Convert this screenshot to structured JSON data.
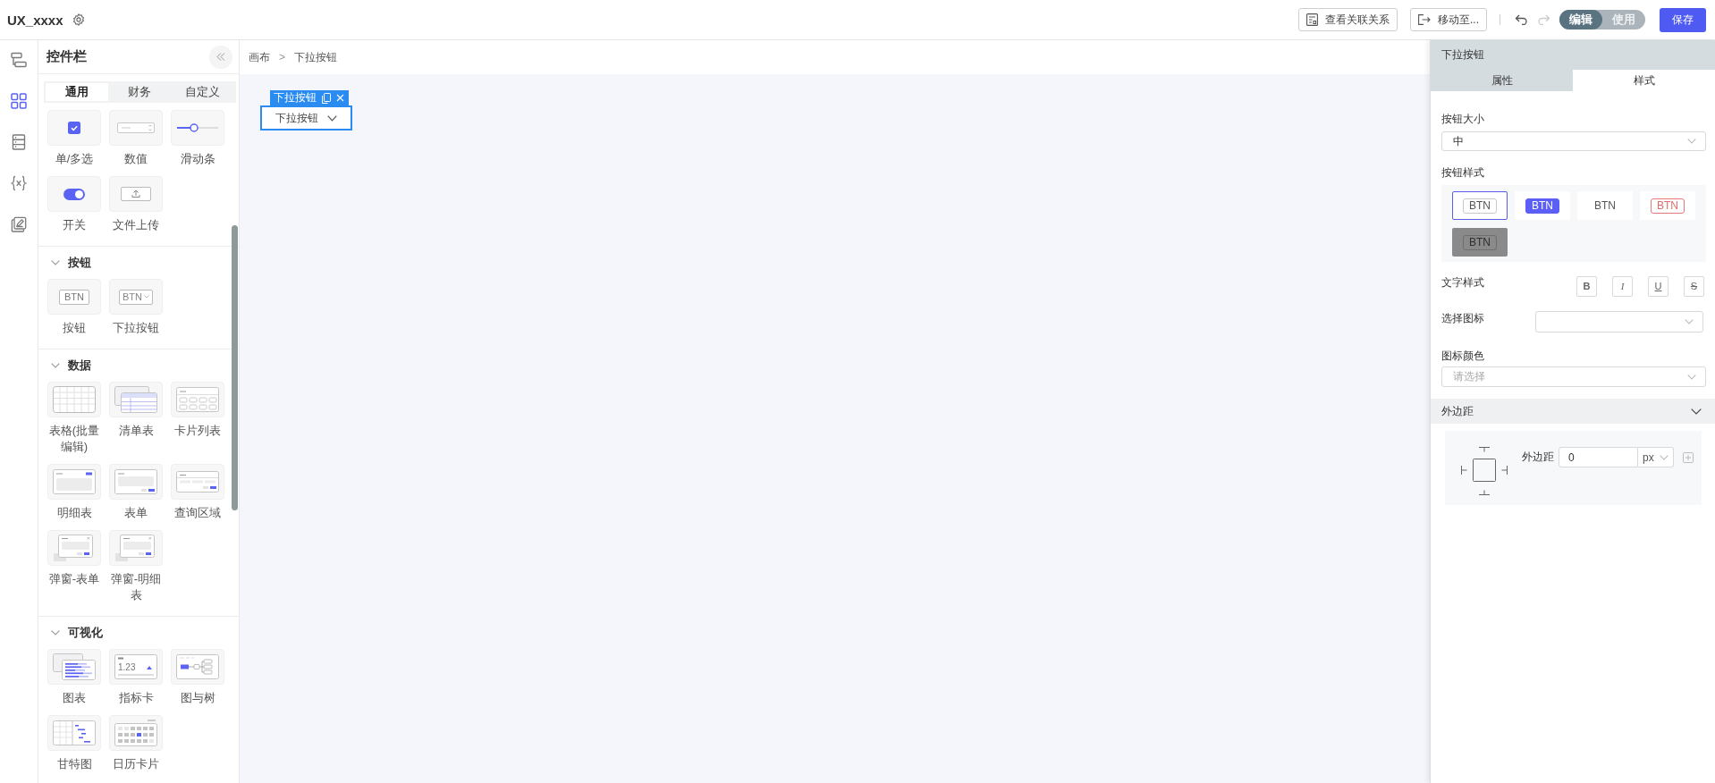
{
  "header": {
    "title": "UX_xxxx",
    "actions": [
      {
        "kind": "relations",
        "label": "查看关联关系"
      },
      {
        "kind": "move",
        "label": "移动至..."
      }
    ],
    "history": [
      {
        "kind": "undo",
        "disabled": false
      },
      {
        "kind": "redo",
        "disabled": true
      }
    ],
    "mode": [
      {
        "label": "编辑",
        "selected": true
      },
      {
        "label": "使用",
        "selected": false
      }
    ],
    "save": {
      "label": "保存"
    }
  },
  "rail": [
    {
      "kind": "layers",
      "selected": false
    },
    {
      "kind": "widgets",
      "selected": true
    },
    {
      "kind": "rows",
      "selected": false
    },
    {
      "kind": "variables",
      "selected": false
    },
    {
      "kind": "edit",
      "selected": false
    }
  ],
  "widget_panel": {
    "title": "控件栏",
    "tabs": [
      {
        "label": "通用",
        "selected": true
      },
      {
        "label": "财务",
        "selected": false
      },
      {
        "label": "自定义",
        "selected": false
      }
    ],
    "sections": [
      {
        "items": [
          {
            "kind": "checkbox",
            "label": "单/多选"
          },
          {
            "kind": "number",
            "label": "数值"
          },
          {
            "kind": "slider",
            "label": "滑动条"
          },
          {
            "kind": "switch",
            "label": "开关"
          },
          {
            "kind": "upload",
            "label": "文件上传"
          }
        ]
      },
      {
        "title": "按钮",
        "expanded": true,
        "items": [
          {
            "kind": "button",
            "label": "按钮",
            "preview": "BTN"
          },
          {
            "kind": "dropdown",
            "label": "下拉按钮",
            "preview": "BTN"
          }
        ]
      },
      {
        "title": "数据",
        "expanded": true,
        "items": [
          {
            "kind": "grid",
            "label": "表格(批量编辑)"
          },
          {
            "kind": "list",
            "label": "清单表"
          },
          {
            "kind": "cards",
            "label": "卡片列表"
          },
          {
            "kind": "detail",
            "label": "明细表"
          },
          {
            "kind": "form",
            "label": "表单"
          },
          {
            "kind": "query",
            "label": "查询区域"
          },
          {
            "kind": "modalform",
            "label": "弹窗-表单"
          },
          {
            "kind": "modaldetail",
            "label": "弹窗-明细表"
          }
        ]
      },
      {
        "title": "可视化",
        "expanded": true,
        "items": [
          {
            "kind": "chart",
            "label": "图表"
          },
          {
            "kind": "metric",
            "label": "指标卡",
            "preview": "1.23"
          },
          {
            "kind": "tree",
            "label": "图与树"
          },
          {
            "kind": "gantt",
            "label": "甘特图"
          },
          {
            "kind": "calendar",
            "label": "日历卡片"
          }
        ]
      }
    ]
  },
  "canvas": {
    "breadcrumb": {
      "items": [
        "画布",
        "下拉按钮"
      ],
      "separator": ">"
    },
    "selected_component": {
      "tag": "下拉按钮",
      "label": "下拉按钮"
    }
  },
  "properties": {
    "title": "下拉按钮",
    "tabs": [
      {
        "label": "属性",
        "selected": false
      },
      {
        "label": "样式",
        "selected": true
      }
    ],
    "size": {
      "label": "按钮大小",
      "value": "中"
    },
    "style": {
      "label": "按钮样式",
      "options": [
        {
          "kind": "outline",
          "label": "BTN",
          "selected": true
        },
        {
          "kind": "primary",
          "label": "BTN",
          "selected": false
        },
        {
          "kind": "text",
          "label": "BTN",
          "selected": false
        },
        {
          "kind": "danger",
          "label": "BTN",
          "selected": false
        },
        {
          "kind": "gray",
          "label": "BTN",
          "selected": false
        }
      ]
    },
    "text_style": {
      "label": "文字样式",
      "buttons": [
        {
          "kind": "bold",
          "label": "B"
        },
        {
          "kind": "italic",
          "label": "I"
        },
        {
          "kind": "underline",
          "label": "U"
        },
        {
          "kind": "strike",
          "label": "S"
        }
      ]
    },
    "icon": {
      "label": "选择图标"
    },
    "icon_color": {
      "label": "图标颜色",
      "placeholder": "请选择"
    },
    "margin": {
      "title": "外边距",
      "expanded": true,
      "label": "外边距",
      "value": "0",
      "unit": "px"
    }
  }
}
